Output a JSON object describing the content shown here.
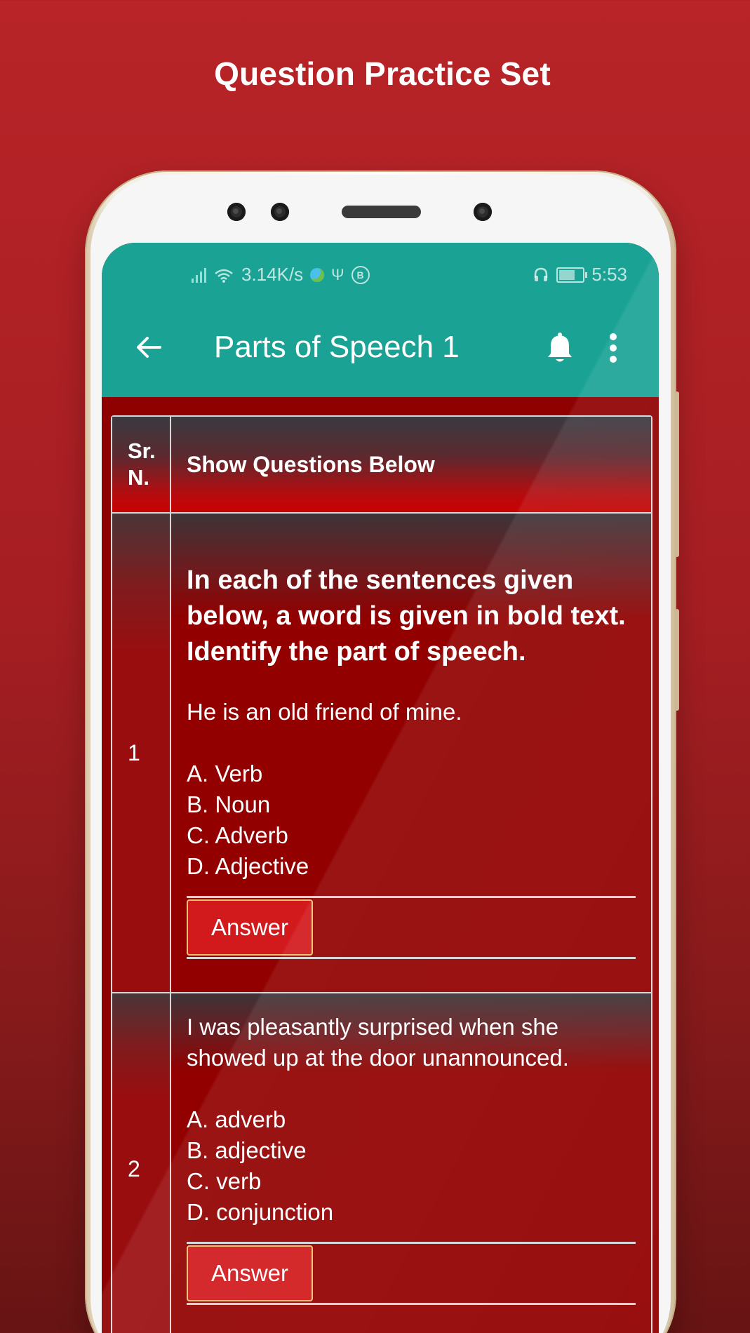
{
  "promo": {
    "title": "Question Practice Set"
  },
  "status_bar": {
    "network_speed": "3.14K/s",
    "time": "5:53",
    "icons_left": [
      "signal-bars-icon",
      "wifi-icon",
      "globe-icon",
      "usb-icon",
      "b-badge-icon"
    ],
    "icons_right": [
      "headphones-icon",
      "battery-icon"
    ]
  },
  "app_bar": {
    "title": "Parts of Speech 1",
    "back_icon": "arrow-left-icon",
    "bell_icon": "bell-icon",
    "menu_icon": "more-vertical-icon",
    "color": "#1aa395"
  },
  "table": {
    "header": {
      "col_no_line1": "Sr.",
      "col_no_line2": "N.",
      "col_question": "Show Questions Below"
    },
    "rows": [
      {
        "number": "1",
        "lead": "In each of the sentences given below, a word is given in bold text. Identify the part of speech.",
        "sentence": "He is an old friend of mine.",
        "options": [
          "A. Verb",
          "B. Noun",
          "C. Adverb",
          "D. Adjective"
        ],
        "answer_label": "Answer"
      },
      {
        "number": "2",
        "sentence": "I was pleasantly surprised when she showed up at the door unannounced.",
        "options": [
          "A. adverb",
          "B. adjective",
          "C. verb",
          "D. conjunction"
        ],
        "answer_label": "Answer"
      }
    ]
  },
  "colors": {
    "background": "#b82428",
    "table_body": "#920000",
    "answer_button": "#d2191c",
    "answer_border": "#e9c270"
  }
}
